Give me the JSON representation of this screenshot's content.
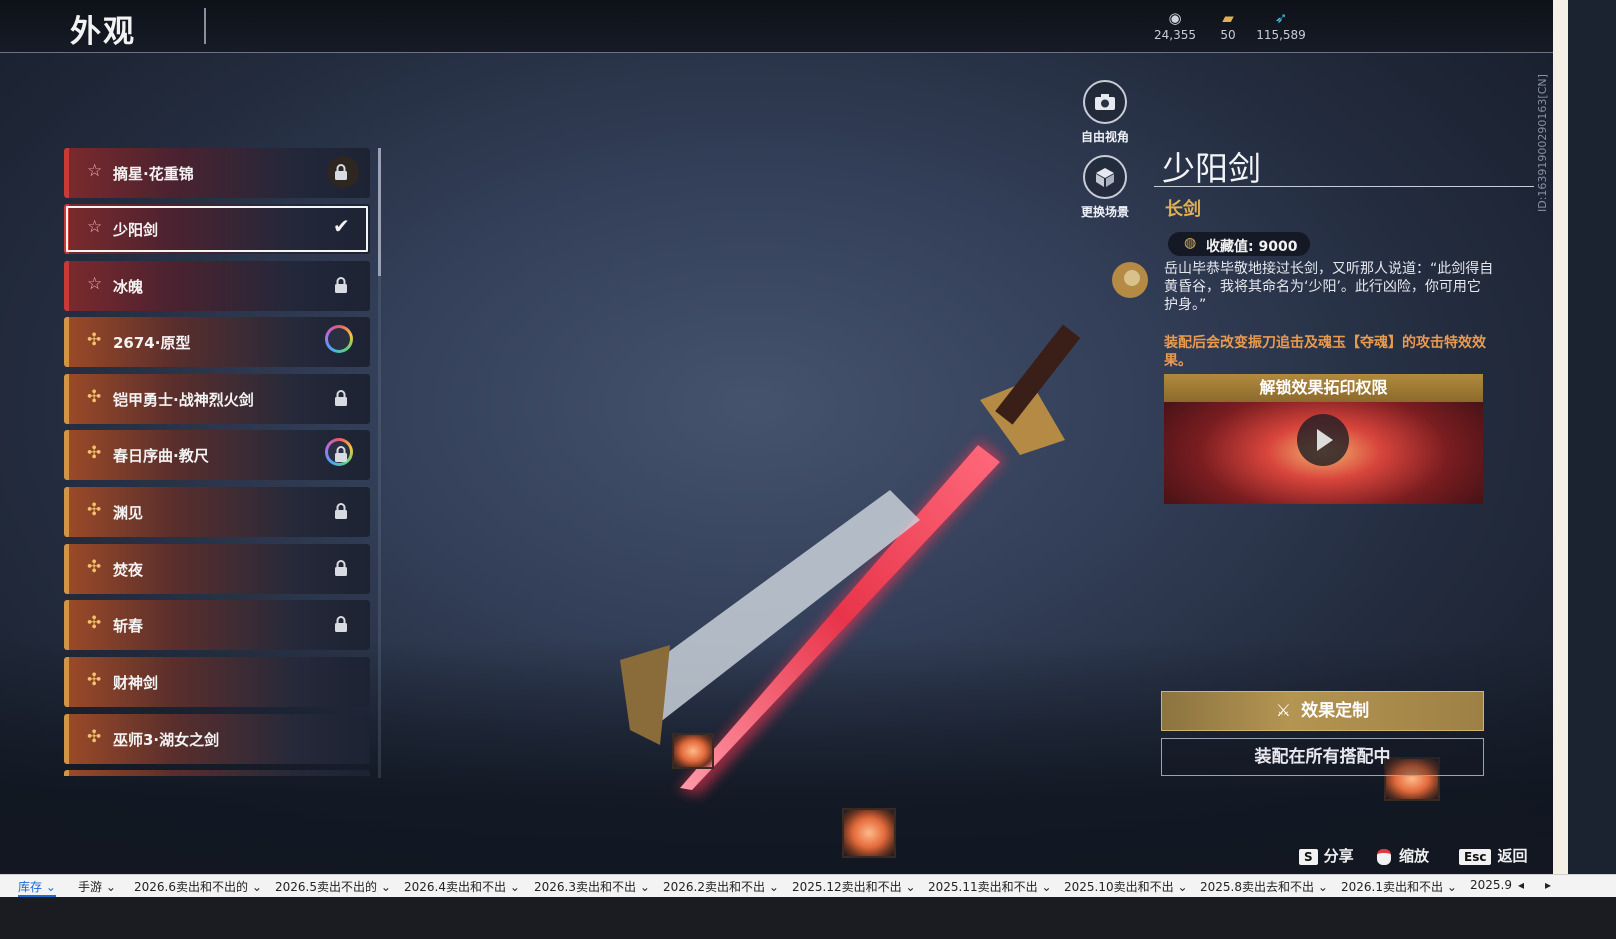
{
  "header": {
    "title": "外观"
  },
  "currencies": [
    {
      "icon": "coin-icon",
      "value": "24,355"
    },
    {
      "icon": "ticket-icon",
      "value": "50"
    },
    {
      "icon": "feather-icon",
      "value": "115,589"
    }
  ],
  "side_id": "ID:1639190029016​3[CN]",
  "list": {
    "items": [
      {
        "label": "摘星·花重锦",
        "rarity": "red",
        "state": "locked"
      },
      {
        "label": "少阳剑",
        "rarity": "red",
        "state": "selected"
      },
      {
        "label": "冰魄",
        "rarity": "red",
        "state": "locked"
      },
      {
        "label": "2674·原型",
        "rarity": "gold",
        "state": "ring"
      },
      {
        "label": "铠甲勇士·战神烈火剑",
        "rarity": "gold",
        "state": "locked"
      },
      {
        "label": "春日序曲·教尺",
        "rarity": "gold",
        "state": "ring-locked"
      },
      {
        "label": "渊见",
        "rarity": "gold",
        "state": "locked"
      },
      {
        "label": "焚夜",
        "rarity": "gold",
        "state": "locked"
      },
      {
        "label": "斩春",
        "rarity": "gold",
        "state": "locked"
      },
      {
        "label": "财神剑",
        "rarity": "gold",
        "state": "none"
      },
      {
        "label": "巫师3·湖女之剑",
        "rarity": "gold",
        "state": "none"
      }
    ]
  },
  "view_buttons": {
    "free_view": "自由视角",
    "change_scene": "更换场景"
  },
  "detail": {
    "name": "少阳剑",
    "type": "长剑",
    "collect_label": "收藏值: 9000",
    "description": "岳山毕恭毕敬地接过长剑，又听那人说道：“此剑得自黄昏谷，我将其命名为‘少阳’。此行凶险，你可用它护身。”",
    "effect_note": "装配后会改变振刀追击及魂玉【夺魂】的攻击特效效果。",
    "video_header": "解锁效果拓印权限",
    "custom_button": "效果定制",
    "equip_button": "装配在所有搭配中"
  },
  "hotkeys": [
    {
      "key": "S",
      "label": "分享"
    },
    {
      "key": "",
      "label": "缩放"
    },
    {
      "key": "Esc",
      "label": "返回"
    }
  ],
  "sheet_tabs": [
    "库存",
    "手游",
    "2026.6卖出和不出的",
    "2026.5卖出不出的",
    "2026.4卖出和不出",
    "2026.3卖出和不出",
    "2026.2卖出和不出",
    "2025.12卖出和不出",
    "2025.11卖出和不出",
    "2025.10卖出和不出",
    "2025.8卖出去和不出",
    "2026.1卖出和不出",
    "2025.9"
  ],
  "colors": {
    "red_rarity": "#c93a37",
    "gold_rarity": "#d29445",
    "accent_gold": "#e0b055",
    "effect_orange": "#e99a4f"
  }
}
